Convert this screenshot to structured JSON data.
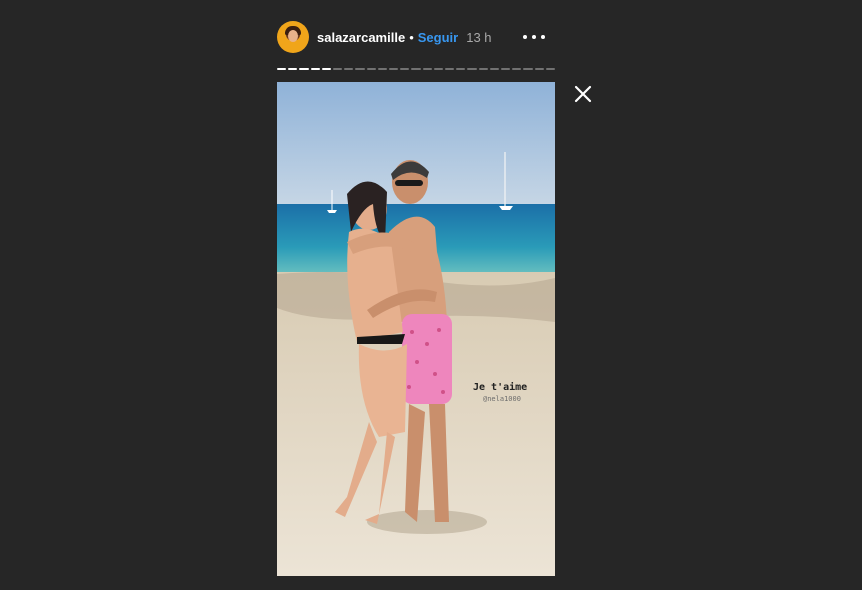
{
  "story": {
    "username": "salazarcamille",
    "separator": "•",
    "follow_label": "Seguir",
    "time_ago": "13 h",
    "progress": {
      "total_segments": 25,
      "completed_segments": 5
    },
    "overlay_text": "Je t'aime",
    "overlay_credit": "@nela1000"
  },
  "icons": {
    "avatar": "avatar",
    "more": "more-horizontal-icon",
    "close": "close-icon"
  },
  "colors": {
    "background": "#262626",
    "follow": "#3897f0",
    "time": "#a8a8a8"
  }
}
